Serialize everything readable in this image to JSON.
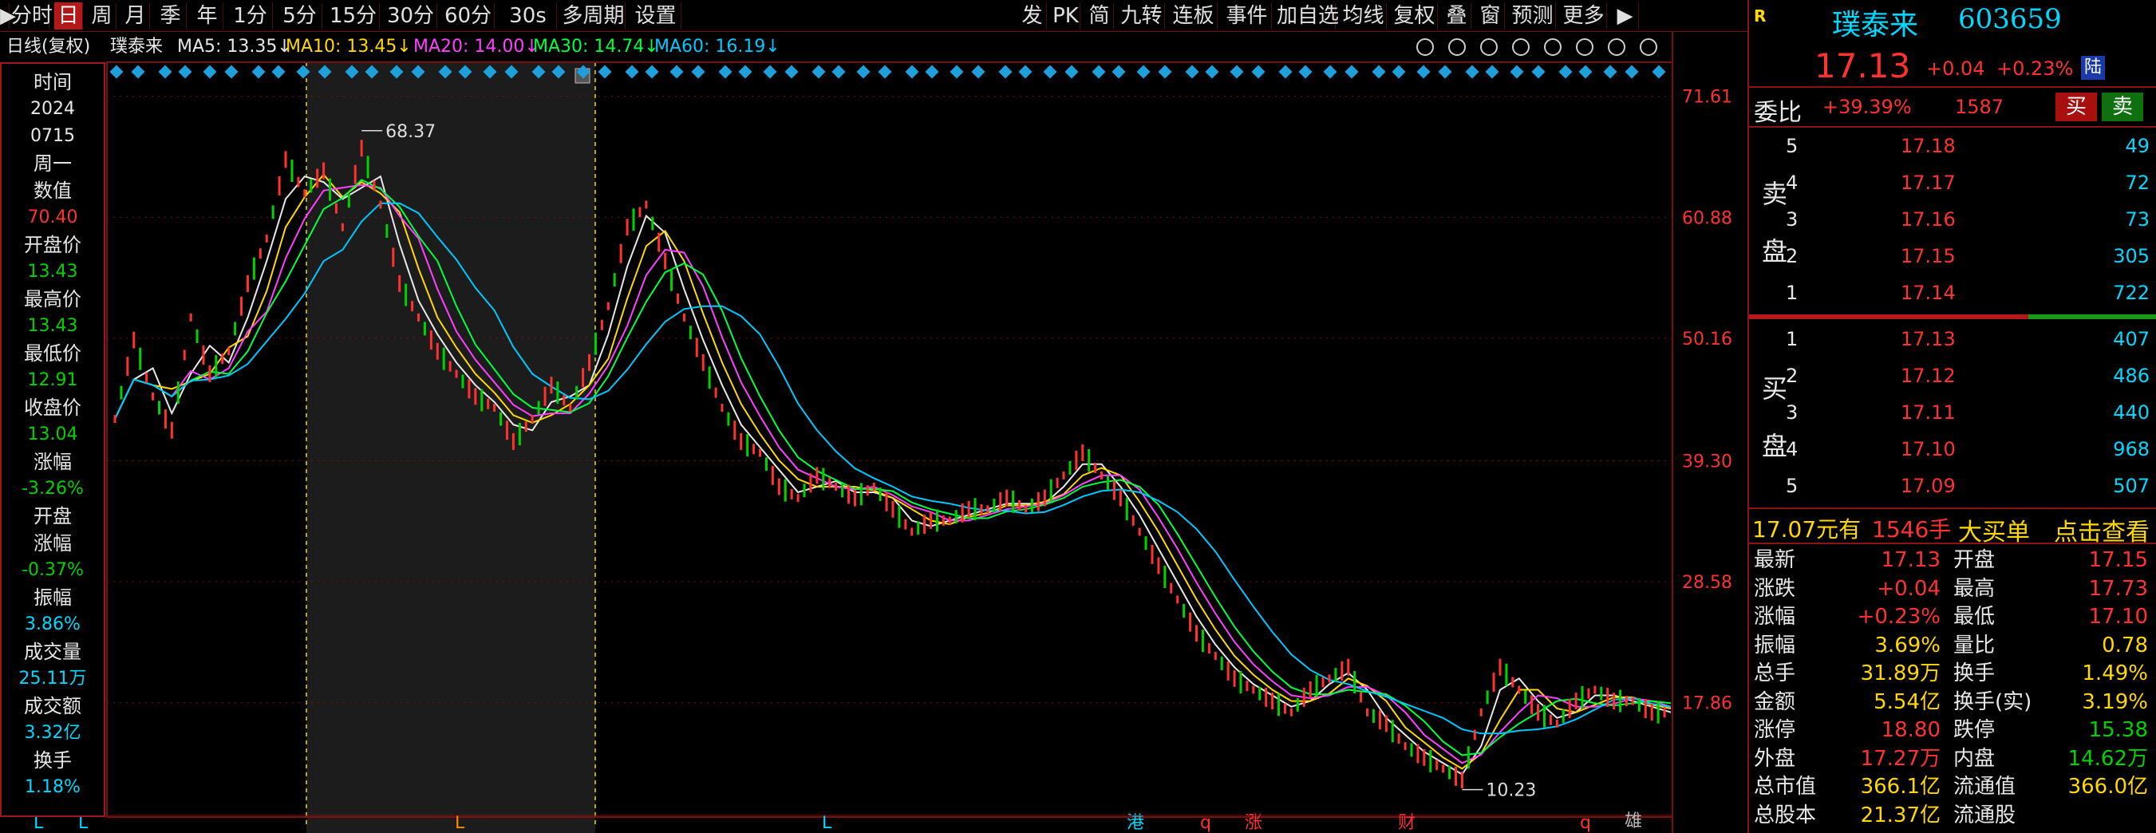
{
  "toolbar": {
    "items": [
      "分时",
      "日",
      "周",
      "月",
      "季",
      "年",
      "1分",
      "5分",
      "15分",
      "30分",
      "60分",
      "30s",
      "多周期",
      "设置"
    ],
    "active_index": 1,
    "right_items": [
      "发",
      "PK",
      "简",
      "九转",
      "连板",
      "事件",
      "加自选",
      "均线",
      "复权",
      "叠",
      "窗",
      "预测",
      "更多"
    ]
  },
  "header": {
    "period": "日线(复权)",
    "stock_name": "璞泰来",
    "ma5": "MA5: 13.35↓",
    "ma10": "MA10: 13.45↓",
    "ma20": "MA20: 14.00↓",
    "ma30": "MA30: 14.74↓",
    "ma60": "MA60: 16.19↓"
  },
  "colors": {
    "up": "#ff3232",
    "down": "#00d200",
    "ma5": "#e8e8e8",
    "ma10": "#ffd800",
    "ma20": "#ff40ff",
    "ma30": "#00ff40",
    "ma60": "#00c8ff",
    "grid": "#7a1010"
  },
  "info_panel": {
    "time_label": "时间",
    "year": "2024",
    "date": "0715",
    "weekday": "周一",
    "value_label": "数值",
    "value": "70.40",
    "open_label": "开盘价",
    "open": "13.43",
    "high_label": "最高价",
    "high": "13.43",
    "low_label": "最低价",
    "low": "12.91",
    "close_label": "收盘价",
    "close": "13.04",
    "change_label": "涨幅",
    "change": "-3.26%",
    "open_change_label1": "开盘",
    "open_change_label2": "涨幅",
    "open_change": "-0.37%",
    "amplitude_label": "振幅",
    "amplitude": "3.86%",
    "volume_label": "成交量",
    "volume": "25.11万",
    "amount_label": "成交额",
    "amount": "3.32亿",
    "turnover_label": "换手",
    "turnover": "1.18%"
  },
  "chart_data": {
    "type": "line",
    "y_ticks": [
      "71.61",
      "60.88",
      "50.16",
      "39.30",
      "28.58",
      "17.86"
    ],
    "ylim": [
      8.0,
      72.5
    ],
    "annotations": {
      "max": "68.37",
      "min": "10.23"
    },
    "x_markers": [
      "L",
      "L",
      "L",
      "L",
      "港",
      "q",
      "涨",
      "财",
      "q"
    ],
    "series": [
      {
        "key": "close",
        "values": [
          43,
          50,
          45,
          42,
          52,
          47,
          49,
          55,
          59,
          66,
          63,
          65,
          60,
          67,
          62,
          55,
          52,
          49,
          47,
          45,
          44,
          41,
          43,
          46,
          44,
          48,
          53,
          60,
          62,
          57,
          52,
          48,
          44,
          41,
          40,
          37,
          36,
          38,
          37,
          36,
          37,
          35,
          33,
          34,
          34,
          35,
          35,
          36,
          35,
          36,
          38,
          40,
          38,
          36,
          33,
          30,
          27,
          24,
          22,
          20,
          19,
          18,
          17,
          19,
          20,
          21,
          17,
          16,
          14,
          13,
          12,
          11,
          17,
          21,
          19,
          17,
          16,
          18,
          19,
          18,
          18,
          17,
          17
        ]
      }
    ]
  },
  "stock": {
    "name": "璞泰来",
    "code": "603659",
    "price": "17.13",
    "change": "+0.04",
    "change_pct": "+0.23%",
    "tag": "陆",
    "r_label": "R",
    "wb_label": "委比",
    "wb_pct": "+39.39%",
    "wb_diff": "1587",
    "buy_btn": "买",
    "sell_btn": "卖"
  },
  "orderbook": {
    "sell_label": [
      "卖",
      "盘"
    ],
    "buy_label": [
      "买",
      "盘"
    ],
    "sells": [
      {
        "n": "5",
        "price": "17.18",
        "vol": "49"
      },
      {
        "n": "4",
        "price": "17.17",
        "vol": "72"
      },
      {
        "n": "3",
        "price": "17.16",
        "vol": "73"
      },
      {
        "n": "2",
        "price": "17.15",
        "vol": "305"
      },
      {
        "n": "1",
        "price": "17.14",
        "vol": "722"
      }
    ],
    "buys": [
      {
        "n": "1",
        "price": "17.13",
        "vol": "407"
      },
      {
        "n": "2",
        "price": "17.12",
        "vol": "486"
      },
      {
        "n": "3",
        "price": "17.11",
        "vol": "440"
      },
      {
        "n": "4",
        "price": "17.10",
        "vol": "968"
      },
      {
        "n": "5",
        "price": "17.09",
        "vol": "507"
      }
    ]
  },
  "big_order": {
    "price": "17.07元有",
    "vol": "1546手",
    "label": "大买单",
    "link": "点击查看"
  },
  "stats": [
    {
      "l1": "最新",
      "v1": "17.13",
      "c1": "red",
      "l2": "开盘",
      "v2": "17.15",
      "c2": "red"
    },
    {
      "l1": "涨跌",
      "v1": "+0.04",
      "c1": "red",
      "l2": "最高",
      "v2": "17.73",
      "c2": "red"
    },
    {
      "l1": "涨幅",
      "v1": "+0.23%",
      "c1": "red",
      "l2": "最低",
      "v2": "17.10",
      "c2": "red"
    },
    {
      "l1": "振幅",
      "v1": "3.69%",
      "c1": "yel",
      "l2": "量比",
      "v2": "0.78",
      "c2": "yel"
    },
    {
      "l1": "总手",
      "v1": "31.89万",
      "c1": "yel",
      "l2": "换手",
      "v2": "1.49%",
      "c2": "yel"
    },
    {
      "l1": "金额",
      "v1": "5.54亿",
      "c1": "yel",
      "l2": "换手(实)",
      "v2": "3.19%",
      "c2": "yel"
    },
    {
      "l1": "涨停",
      "v1": "18.80",
      "c1": "red",
      "l2": "跌停",
      "v2": "15.38",
      "c2": "grn"
    },
    {
      "l1": "外盘",
      "v1": "17.27万",
      "c1": "red",
      "l2": "内盘",
      "v2": "14.62万",
      "c2": "grn"
    },
    {
      "l1": "总市值",
      "v1": "366.1亿",
      "c1": "yel",
      "l2": "流通值",
      "v2": "366.0亿",
      "c2": "yel"
    },
    {
      "l1": "总股本",
      "v1": "21.37亿",
      "c1": "yel",
      "l2": "流通股",
      "v2": "",
      "c2": "yel"
    }
  ],
  "watermark": "雄"
}
